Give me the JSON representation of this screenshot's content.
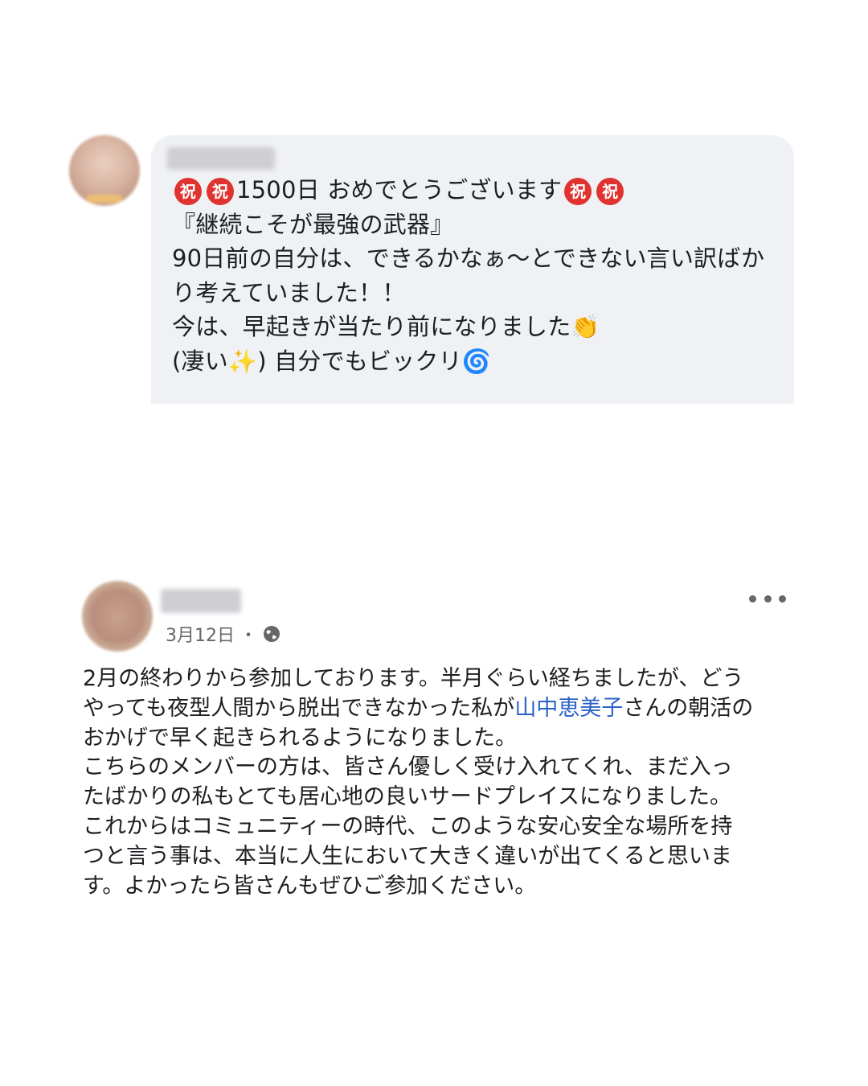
{
  "comment": {
    "lines": [
      {
        "pre": "",
        "post": "1500日 おめでとうございます"
      },
      "『継続こそが最強の武器』",
      "90日前の自分は、できるかなぁ〜とできない言い訳ばか",
      "り考えていました！！",
      {
        "text": "今は、早起きが当たり前になりました",
        "emoji": "👏"
      },
      {
        "pre": "(凄い",
        "emoji": "✨",
        "post": ") 自分でもビックリ",
        "emoji2": "🌀"
      }
    ],
    "iwai_char": "祝"
  },
  "post": {
    "date": "3月12日",
    "separator": "・",
    "privacy_icon": "globe-icon",
    "more_icon": "more-options-icon",
    "lines": [
      "2月の終わりから参加しております。半月ぐらい経ちましたが、どう",
      {
        "pre": "やっても夜型人間から脱出できなかった私が",
        "link": "山中恵美子",
        "post": "さんの朝活の"
      },
      "おかげで早く起きられるようになりました。",
      "こちらのメンバーの方は、皆さん優しく受け入れてくれ、まだ入っ",
      "たばかりの私もとても居心地の良いサードプレイスになりました。",
      "これからはコミュニティーの時代、このような安心安全な場所を持",
      "つと言う事は、本当に人生において大きく違いが出てくると思いま",
      "す。よかったら皆さんもぜひご参加ください。"
    ]
  },
  "colors": {
    "bubble": "#eff1f4",
    "link": "#2b62c7",
    "meta": "#65676b",
    "iwai": "#e0322f"
  }
}
